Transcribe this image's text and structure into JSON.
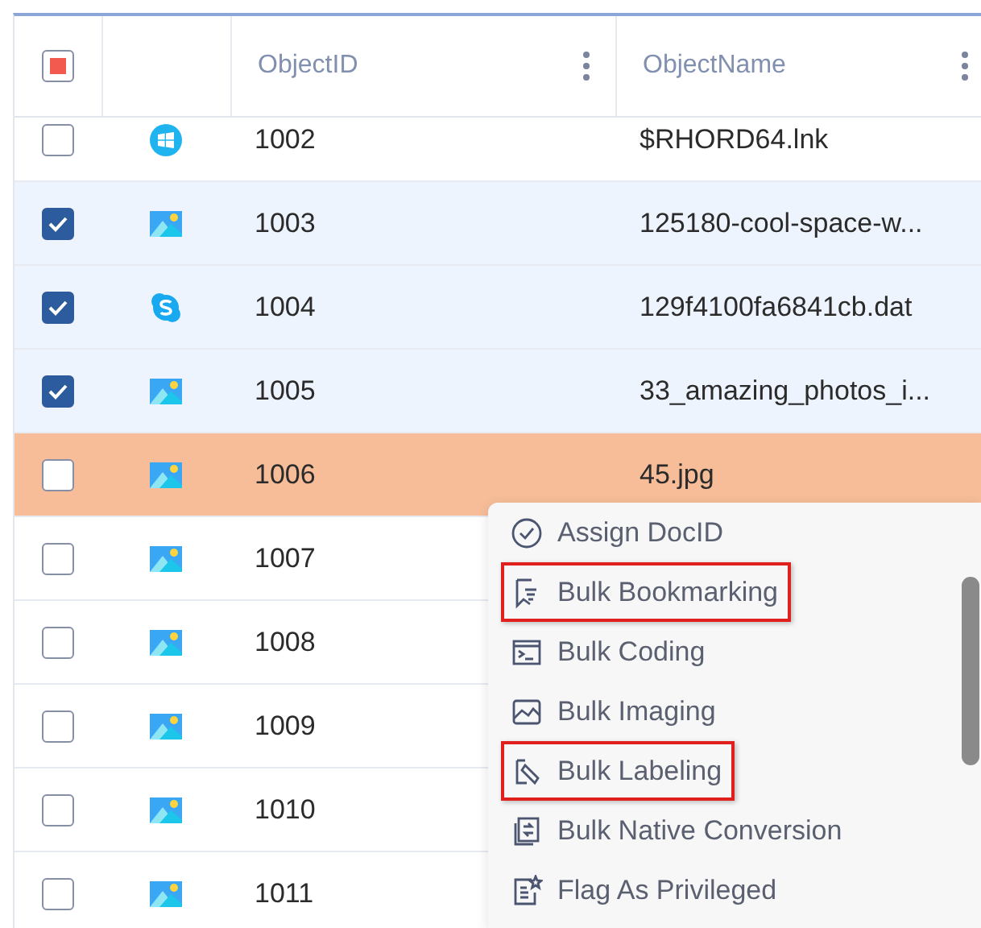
{
  "table": {
    "select_all": {
      "indeterminate": true
    },
    "columns": [
      {
        "label": "ObjectID"
      },
      {
        "label": "ObjectName"
      }
    ],
    "rows": [
      {
        "checked": false,
        "highlighted": false,
        "kind": "windows",
        "id": "1002",
        "name": "$RHORD64.lnk"
      },
      {
        "checked": true,
        "highlighted": false,
        "kind": "image",
        "id": "1003",
        "name": "125180-cool-space-w..."
      },
      {
        "checked": true,
        "highlighted": false,
        "kind": "skype",
        "id": "1004",
        "name": "129f4100fa6841cb.dat"
      },
      {
        "checked": true,
        "highlighted": false,
        "kind": "image",
        "id": "1005",
        "name": "33_amazing_photos_i..."
      },
      {
        "checked": false,
        "highlighted": true,
        "kind": "image",
        "id": "1006",
        "name": "45.jpg"
      },
      {
        "checked": false,
        "highlighted": false,
        "kind": "image",
        "id": "1007"
      },
      {
        "checked": false,
        "highlighted": false,
        "kind": "image",
        "id": "1008"
      },
      {
        "checked": false,
        "highlighted": false,
        "kind": "image",
        "id": "1009"
      },
      {
        "checked": false,
        "highlighted": false,
        "kind": "image",
        "id": "1010"
      },
      {
        "checked": false,
        "highlighted": false,
        "kind": "image",
        "id": "1011"
      }
    ]
  },
  "context_menu": {
    "items": [
      {
        "kind": "assign",
        "label": "Assign DocID",
        "outlined": false
      },
      {
        "kind": "bookmark",
        "label": "Bulk Bookmarking",
        "outlined": true
      },
      {
        "kind": "coding",
        "label": "Bulk Coding",
        "outlined": false
      },
      {
        "kind": "imaging",
        "label": "Bulk Imaging",
        "outlined": false
      },
      {
        "kind": "labeling",
        "label": "Bulk Labeling",
        "outlined": true
      },
      {
        "kind": "conversion",
        "label": "Bulk Native Conversion",
        "outlined": false
      },
      {
        "kind": "privileged",
        "label": "Flag As Privileged",
        "outlined": false
      }
    ]
  }
}
